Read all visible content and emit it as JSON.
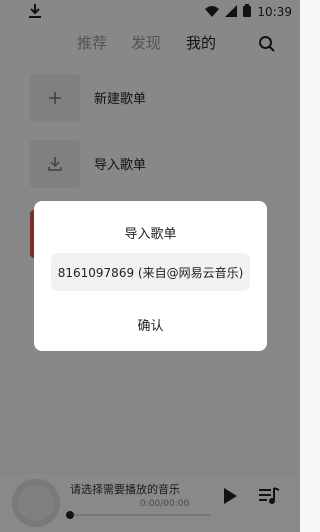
{
  "status_bar": {
    "time": "10:39",
    "icons": [
      "download-icon",
      "wifi-icon",
      "signal-icon",
      "battery-icon"
    ]
  },
  "tabs": [
    {
      "label": "推荐",
      "active": false
    },
    {
      "label": "发现",
      "active": false
    },
    {
      "label": "我的",
      "active": true
    }
  ],
  "playlist_actions": [
    {
      "label": "新建歌单",
      "icon": "plus-icon"
    },
    {
      "label": "导入歌单",
      "icon": "import-icon"
    }
  ],
  "player": {
    "title": "请选择需要播放的音乐",
    "time": "0:00/00:00",
    "progress": 0
  },
  "dialog": {
    "title": "导入歌单",
    "value": "8161097869 (来自@网易云音乐)",
    "confirm": "确认"
  },
  "colors": {
    "overlay": "#000000",
    "accent_peek": "#e05555"
  }
}
